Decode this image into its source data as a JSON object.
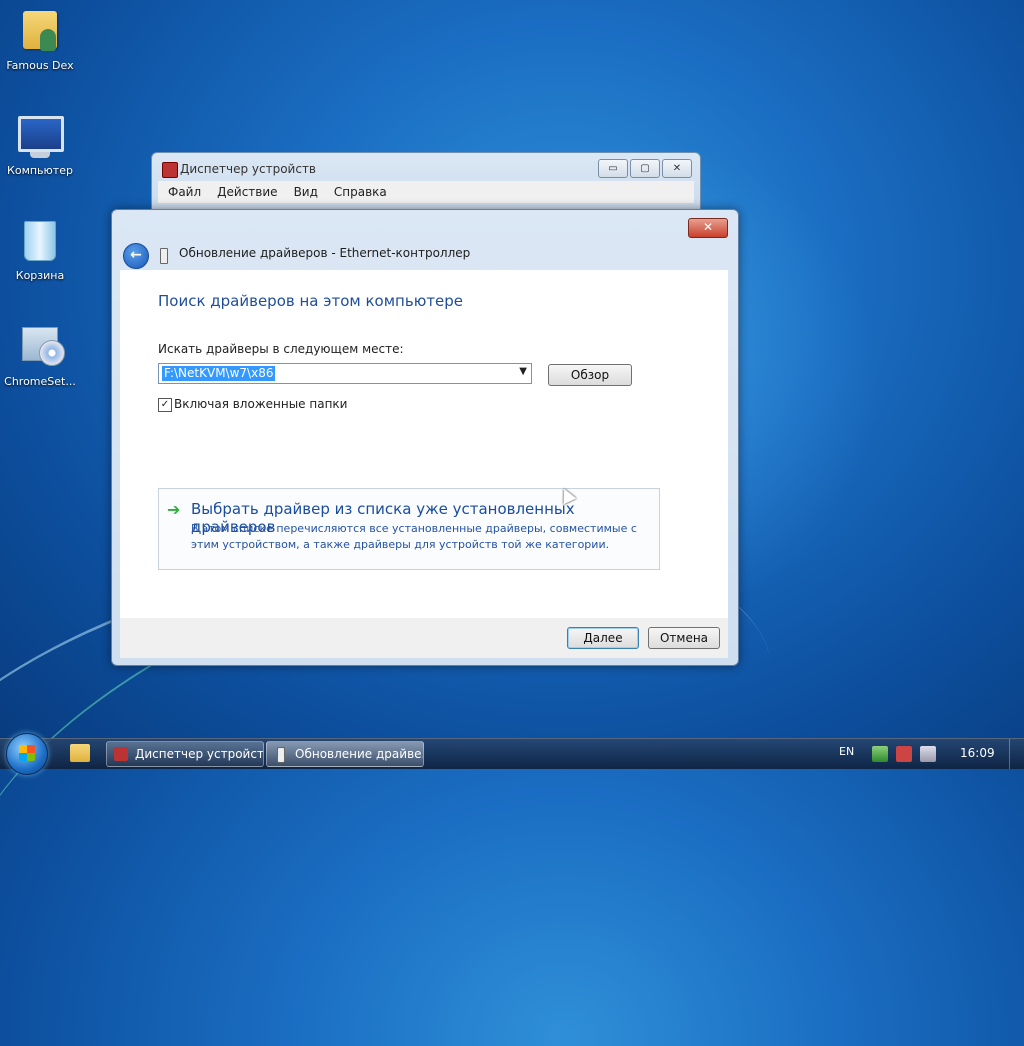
{
  "desktop": {
    "icons": [
      {
        "label": "Famous Dex"
      },
      {
        "label": "Компьютер"
      },
      {
        "label": "Корзина"
      },
      {
        "label": "ChromeSet..."
      }
    ]
  },
  "device_manager": {
    "title": "Диспетчер устройств",
    "menu": [
      "Файл",
      "Действие",
      "Вид",
      "Справка"
    ],
    "buttons": {
      "minimize": "▭",
      "maximize": "▢",
      "close": "✕"
    }
  },
  "wizard": {
    "close": "✕",
    "back": "←",
    "title": "Обновление драйверов - Ethernet-контроллер",
    "heading": "Поиск драйверов на этом компьютере",
    "search_label": "Искать драйверы в следующем месте:",
    "path_value": "F:\\NetKVM\\w7\\x86",
    "browse_label": "Обзор",
    "include_subfolders": {
      "label": "Включая вложенные папки",
      "checked": true,
      "mark": "✓"
    },
    "pick_option": {
      "title": "Выбрать драйвер из списка уже установленных драйверов",
      "description": "В этом списке перечисляются все установленные драйверы, совместимые с этим устройством, а также драйверы для устройств той же категории."
    },
    "next_label": "Далее",
    "cancel_label": "Отмена"
  },
  "taskbar": {
    "tasks": [
      {
        "label": "Диспетчер устройств"
      },
      {
        "label": "Обновление драйве..."
      }
    ],
    "language": "EN",
    "clock": "16:09"
  },
  "colors": {
    "heading": "#1e4e9a",
    "link": "#1a4da0",
    "selection": "#3399ff",
    "close_red": "#c8402c"
  }
}
